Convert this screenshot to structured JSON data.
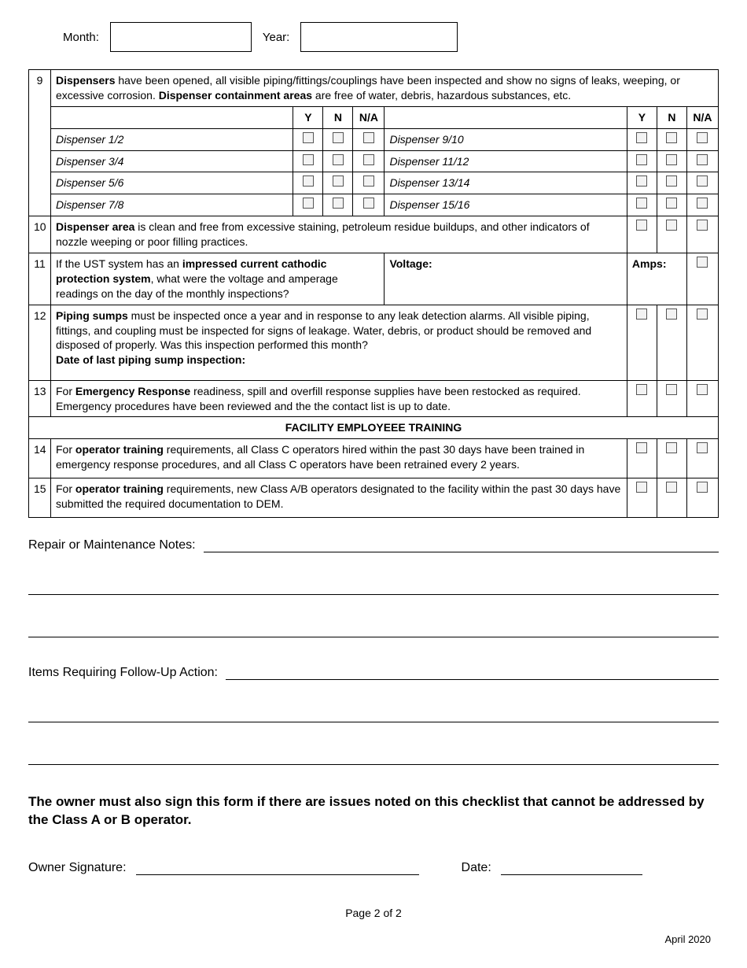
{
  "header": {
    "month_label": "Month:",
    "year_label": "Year:"
  },
  "row9": {
    "num": "9",
    "intro_html": "<b>Dispensers</b> have been opened, all visible piping/fittings/couplings have been inspected and show no signs of leaks, weeping, or excessive corrosion. <b>Dispenser containment areas</b> are free of water, debris, hazardous substances, etc.",
    "cols": {
      "y": "Y",
      "n": "N",
      "na": "N/A"
    },
    "left": [
      "Dispenser 1/2",
      "Dispenser 3/4",
      "Dispenser 5/6",
      "Dispenser 7/8"
    ],
    "right": [
      "Dispenser 9/10",
      "Dispenser 11/12",
      "Dispenser 13/14",
      "Dispenser 15/16"
    ]
  },
  "row10": {
    "num": "10",
    "text_html": "<b>Dispenser area</b>  is clean and free from excessive staining, petroleum residue buildups, and other indicators of nozzle weeping or poor filling practices."
  },
  "row11": {
    "num": "11",
    "text_html": "If the UST system has an <b>impressed current cathodic protection system</b>, what were the voltage and amperage readings on the day of the monthly inspections?",
    "voltage": "Voltage:",
    "amps": "Amps:"
  },
  "row12": {
    "num": "12",
    "text_html": "<b>Piping sumps</b> must be inspected once a year and in response to any leak detection alarms. All visible piping, fittings, and coupling must be inspected for signs of leakage. Water, debris, or product should be removed and disposed of properly. Was this inspection performed this month?<br><b>Date of last piping sump inspection:</b>"
  },
  "row13": {
    "num": "13",
    "text_html": "For <b>Emergency Response</b> readiness, spill and overfill response supplies have been restocked as required. Emergency procedures have been reviewed and the the contact list is up to date."
  },
  "section": "FACILITY EMPLOYEEE TRAINING",
  "row14": {
    "num": "14",
    "text_html": "For <b>operator training</b> requirements, all Class C operators hired within the past 30 days have been trained in emergency response procedures, and all Class C operators have been retrained every 2 years."
  },
  "row15": {
    "num": "15",
    "text_html": "For <b>operator training</b> requirements, new Class A/B operators designated to the facility within the past 30 days have submitted the required documentation to DEM."
  },
  "notes": {
    "repair": "Repair or Maintenance Notes:",
    "followup": "Items Requiring Follow-Up Action:"
  },
  "owner_note": "The owner must also sign this form if there are issues noted on this checklist that cannot be addressed by the Class A or B operator.",
  "signature": {
    "owner": "Owner Signature:",
    "date": "Date:"
  },
  "footer": {
    "page": "Page 2 of 2",
    "rev": "April 2020"
  }
}
